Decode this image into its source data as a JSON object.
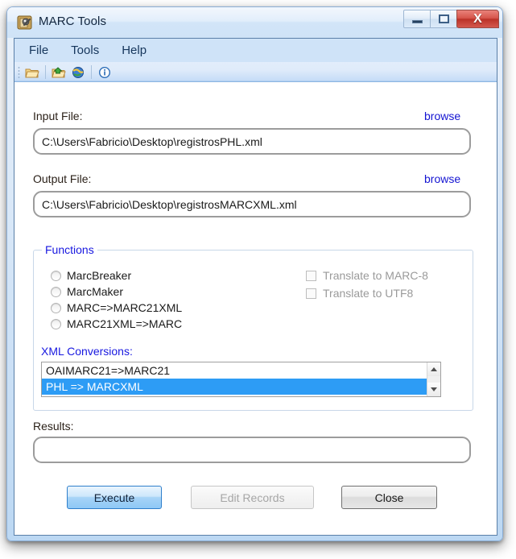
{
  "window": {
    "title": "MARC Tools",
    "icon": "marc-tools-app-icon",
    "controls": {
      "minimize": "minimize-button",
      "maximize": "maximize-button",
      "close": "close-button",
      "close_glyph": "X"
    }
  },
  "menu": {
    "items": [
      {
        "label": "File"
      },
      {
        "label": "Tools"
      },
      {
        "label": "Help"
      }
    ]
  },
  "toolbar": {
    "icons": [
      {
        "name": "open-folder-icon"
      },
      {
        "name": "save-folder-icon"
      },
      {
        "name": "globe-icon"
      },
      {
        "name": "info-icon"
      }
    ]
  },
  "input_file": {
    "label": "Input File:",
    "browse_label": "browse",
    "value": "C:\\Users\\Fabricio\\Desktop\\registrosPHL.xml",
    "placeholder": ""
  },
  "output_file": {
    "label": "Output File:",
    "browse_label": "browse",
    "value": "C:\\Users\\Fabricio\\Desktop\\registrosMARCXML.xml",
    "placeholder": ""
  },
  "functions": {
    "legend": "Functions",
    "radios": [
      {
        "label": "MarcBreaker",
        "checked": false
      },
      {
        "label": "MarcMaker",
        "checked": false
      },
      {
        "label": "MARC=>MARC21XML",
        "checked": false
      },
      {
        "label": "MARC21XML=>MARC",
        "checked": false
      }
    ],
    "checkboxes": [
      {
        "label": "Translate to MARC-8",
        "checked": false,
        "enabled": false
      },
      {
        "label": "Translate to UTF8",
        "checked": false,
        "enabled": false
      }
    ],
    "xml_conversions": {
      "title": "XML Conversions:",
      "items": [
        {
          "label": "OAIMARC21=>MARC21",
          "selected": false
        },
        {
          "label": "PHL => MARCXML",
          "selected": true
        }
      ]
    }
  },
  "results": {
    "label": "Results:",
    "value": "",
    "placeholder": ""
  },
  "buttons": {
    "execute": "Execute",
    "edit_records": "Edit Records",
    "close": "Close"
  },
  "colors": {
    "selection_blue": "#2d9cf5",
    "link_blue": "#1414d2",
    "legend_blue": "#1818e0",
    "close_red": "#bb3228",
    "menu_bar": "#cfe3f8"
  }
}
